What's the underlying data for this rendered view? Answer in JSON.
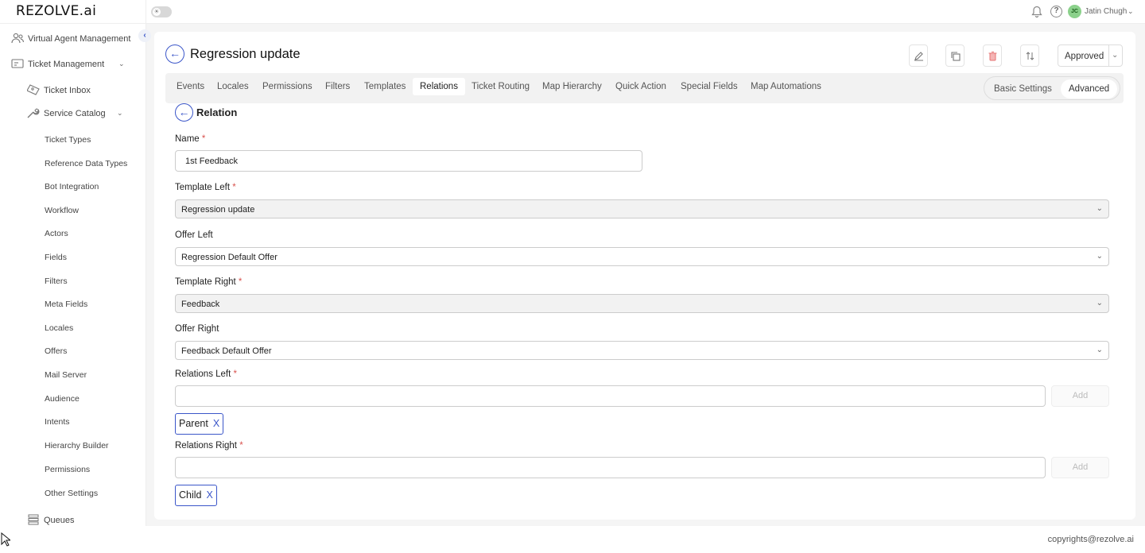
{
  "app": {
    "logo": "REZOLVE.ai",
    "username": "Jatin Chugh",
    "avatar_initials": "JC",
    "footer": "copyrights@rezolve.ai"
  },
  "sidebar": {
    "top_items": [
      {
        "label": "Virtual Agent Management",
        "icon": "people-icon"
      },
      {
        "label": "Ticket Management",
        "icon": "ticket-management-icon"
      }
    ],
    "ticket_inbox": "Ticket Inbox",
    "service_catalog": "Service Catalog",
    "catalog_items": [
      "Ticket Types",
      "Reference Data Types",
      "Bot Integration",
      "Workflow",
      "Actors",
      "Fields",
      "Filters",
      "Meta Fields",
      "Locales",
      "Offers",
      "Mail Server",
      "Audience",
      "Intents",
      "Hierarchy Builder",
      "Permissions",
      "Other Settings"
    ],
    "queues": "Queues"
  },
  "header": {
    "title": "Regression update",
    "status": "Approved"
  },
  "tabs": [
    "Events",
    "Locales",
    "Permissions",
    "Filters",
    "Templates",
    "Relations",
    "Ticket Routing",
    "Map Hierarchy",
    "Quick Action",
    "Special Fields",
    "Map Automations"
  ],
  "active_tab": "Relations",
  "mode": {
    "basic": "Basic Settings",
    "advanced": "Advanced",
    "selected": "Advanced"
  },
  "form": {
    "section_title": "Relation",
    "name_label": "Name",
    "name_value": "1st Feedback",
    "template_left_label": "Template Left",
    "template_left_value": "Regression update",
    "offer_left_label": "Offer Left",
    "offer_left_value": "Regression Default Offer",
    "template_right_label": "Template Right",
    "template_right_value": "Feedback",
    "offer_right_label": "Offer Right",
    "offer_right_value": "Feedback Default Offer",
    "relations_left_label": "Relations Left",
    "relations_left_value": "",
    "relations_left_chip": "Parent",
    "relations_right_label": "Relations Right",
    "relations_right_value": "",
    "relations_right_chip": "Child",
    "add_label": "Add",
    "chip_remove": "X",
    "required_mark": "*"
  },
  "colors": {
    "accent": "#3b56c9",
    "required": "#d9534f",
    "delete": "#e57373",
    "avatar_bg": "#8bd18b"
  }
}
